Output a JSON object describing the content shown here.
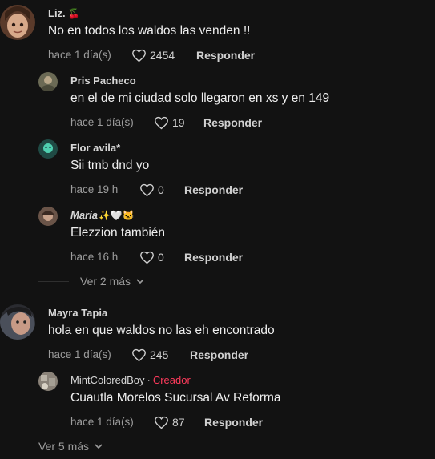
{
  "comments": [
    {
      "name": "Liz.",
      "emoji": "🍒",
      "text": "No en todos los waldos las venden !!",
      "time": "hace 1 día(s)",
      "likes": "2454",
      "reply": "Responder"
    },
    {
      "name": "Pris Pacheco",
      "text": "en el de mi ciudad solo llegaron en xs y en 149",
      "time": "hace 1 día(s)",
      "likes": "19",
      "reply": "Responder"
    },
    {
      "name": "Flor avila*",
      "text": "Sii tmb dnd yo",
      "time": "hace 19 h",
      "likes": "0",
      "reply": "Responder"
    },
    {
      "name": "Maria",
      "emoji": "✨🤍🐱",
      "text": "Elezzion también",
      "time": "hace 16 h",
      "likes": "0",
      "reply": "Responder"
    },
    {
      "name": "Mayra Tapia",
      "text": "hola en que waldos no las eh encontrado",
      "time": "hace 1 día(s)",
      "likes": "245",
      "reply": "Responder"
    },
    {
      "name": "MintColoredBoy",
      "badge": "Creador",
      "text": "Cuautla Morelos Sucursal Av Reforma",
      "time": "hace 1 día(s)",
      "likes": "87",
      "reply": "Responder"
    }
  ],
  "more_replies_1": "Ver 2 más",
  "more_replies_2": "Ver 5 más",
  "colors": {
    "background": "#121212",
    "creator": "#ff3b5c",
    "muted": "#9c9c9c"
  }
}
